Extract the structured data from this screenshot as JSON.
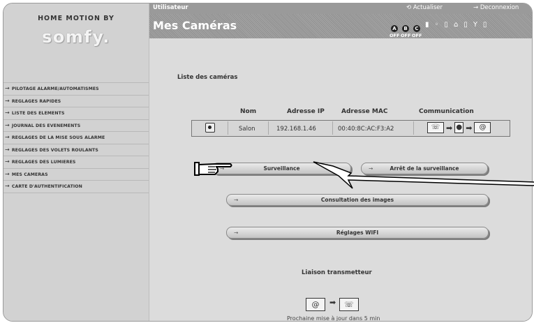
{
  "sidebar": {
    "logo_top": "HOME MOTION BY",
    "logo_main": "somfy.",
    "menu": [
      "PILOTAGE ALARME/AUTOMATISMES",
      "REGLAGES RAPIDES",
      "LISTE DES ELEMENTS",
      "JOURNAL DES EVENEMENTS",
      "REGLAGES DE LA MISE SOUS ALARME",
      "REGLAGES DES VOLETS ROULANTS",
      "REGLAGES DES LUMIERES",
      "MES CAMERAS",
      "CARTE D'AUTHENTIFICATION"
    ]
  },
  "topbar": {
    "user": "Utilisateur",
    "refresh": "Actualiser",
    "logout": "Deconnexion"
  },
  "header": {
    "title": "Mes Caméras",
    "status": [
      {
        "letter": "A",
        "label": "OFF"
      },
      {
        "letter": "B",
        "label": "OFF"
      },
      {
        "letter": "C",
        "label": "OFF"
      }
    ]
  },
  "cameras": {
    "list_title": "Liste des caméras",
    "columns": [
      "Nom",
      "Adresse IP",
      "Adresse MAC",
      "Communication"
    ],
    "rows": [
      {
        "name": "Salon",
        "ip": "192.168.1.46",
        "mac": "00:40:8C:AC:F3:A2"
      }
    ]
  },
  "buttons": {
    "surveillance": "Surveillance",
    "stop": "Arrêt de la surveillance",
    "images": "Consultation des images",
    "wifi": "Réglages WIFI"
  },
  "liaison": {
    "title": "Liaison transmetteur",
    "next_update": "Prochaine mise à jour dans 5 min"
  }
}
